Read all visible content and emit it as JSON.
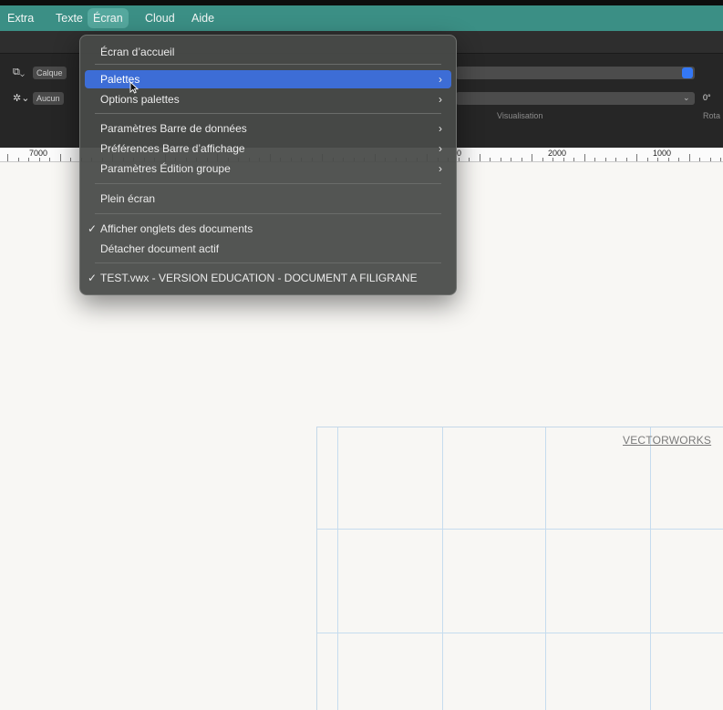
{
  "menubar": {
    "items": [
      {
        "label": "Extra"
      },
      {
        "label": "Texte"
      },
      {
        "label": "Écran"
      },
      {
        "label": "Cloud"
      },
      {
        "label": "Aide"
      }
    ],
    "active": "Écran"
  },
  "toolbar": {
    "layer_chip": "Calque",
    "class_chip": "Aucun",
    "visualisation_label": "Visualisation",
    "rotation_value": "0°",
    "rotation_label": "Rota"
  },
  "ruler": {
    "labels": [
      "7000",
      "0",
      "2000",
      "1000"
    ]
  },
  "dropdown": {
    "items": [
      {
        "label": "Écran d’accueil",
        "submenu": false,
        "checked": false
      },
      {
        "label": "Palettes",
        "submenu": true,
        "checked": false,
        "highlighted": true
      },
      {
        "label": "Options palettes",
        "submenu": true,
        "checked": false
      },
      {
        "label": "Paramètres Barre de données",
        "submenu": true,
        "checked": false
      },
      {
        "label": "Préférences Barre d’affichage",
        "submenu": true,
        "checked": false
      },
      {
        "label": "Paramètres Édition groupe",
        "submenu": true,
        "checked": false
      },
      {
        "label": "Plein écran",
        "submenu": false,
        "checked": false
      },
      {
        "label": "Afficher onglets des documents",
        "submenu": false,
        "checked": true
      },
      {
        "label": "Détacher document actif",
        "submenu": false,
        "checked": false
      },
      {
        "label": "TEST.vwx - VERSION EDUCATION - DOCUMENT A FILIGRANE",
        "submenu": false,
        "checked": true
      }
    ],
    "check_glyph": "✓",
    "chevron_glyph": "›"
  },
  "canvas": {
    "watermark": "VECTORWORKS"
  },
  "colors": {
    "menubar": "#3b8f85",
    "highlight": "#3d6dd6",
    "accent_blue": "#3478f6"
  }
}
